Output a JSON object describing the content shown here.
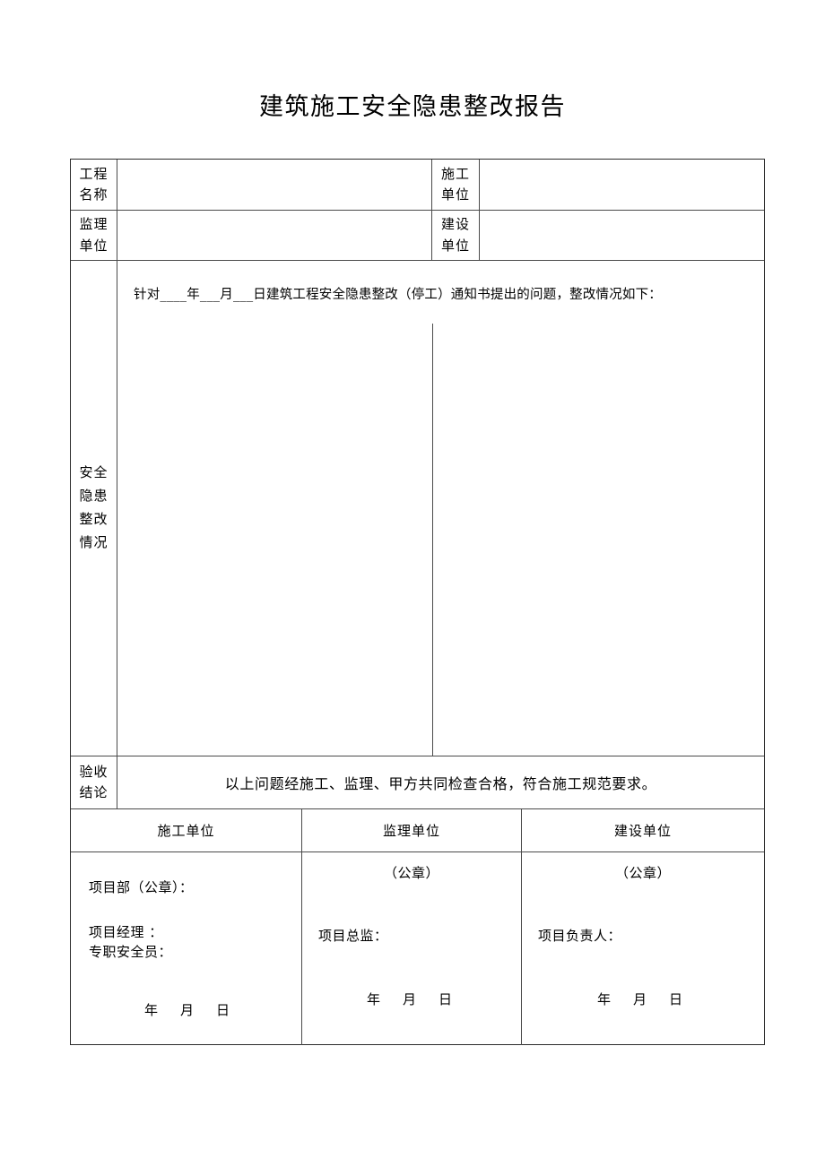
{
  "document": {
    "title": "建筑施工安全隐患整改报告"
  },
  "info_rows": [
    {
      "left_label_line1": "工程",
      "left_label_line2": "名称",
      "left_value": "",
      "right_label_line1": "施工",
      "right_label_line2": "单位",
      "right_value": ""
    },
    {
      "left_label_line1": "监理",
      "left_label_line2": "单位",
      "left_value": "",
      "right_label_line1": "建设",
      "right_label_line2": "单位",
      "right_value": ""
    }
  ],
  "narrative": {
    "label_lines": [
      "安全",
      "隐患",
      "整改",
      "情况"
    ],
    "intro_text": "针对____年___月___日建筑工程安全隐患整改（停工）通知书提出的问题，整改情况如下：",
    "body_text": ""
  },
  "conclusion": {
    "label_lines": [
      "验收",
      "结论"
    ],
    "text": "以上问题经施工、监理、甲方共同检查合格，符合施工规范要求。"
  },
  "signature_header": [
    "施工单位",
    "监理单位",
    "建设单位"
  ],
  "signature_blocks": [
    {
      "stamp": "",
      "lines": [
        "项目部（公章）：",
        "项目经理 ：",
        "专职安全员："
      ],
      "date_year": "年",
      "date_month": "月",
      "date_day": "日"
    },
    {
      "stamp": "（公章）",
      "lines": [
        "项目总监："
      ],
      "date_year": "年",
      "date_month": "月",
      "date_day": "日"
    },
    {
      "stamp": "（公章）",
      "lines": [
        "项目负责人："
      ],
      "date_year": "年",
      "date_month": "月",
      "date_day": "日"
    }
  ],
  "colors": {
    "border": "#4a4a4a",
    "outer_border": "#2b2b2b",
    "text": "#000000",
    "background": "#ffffff"
  }
}
